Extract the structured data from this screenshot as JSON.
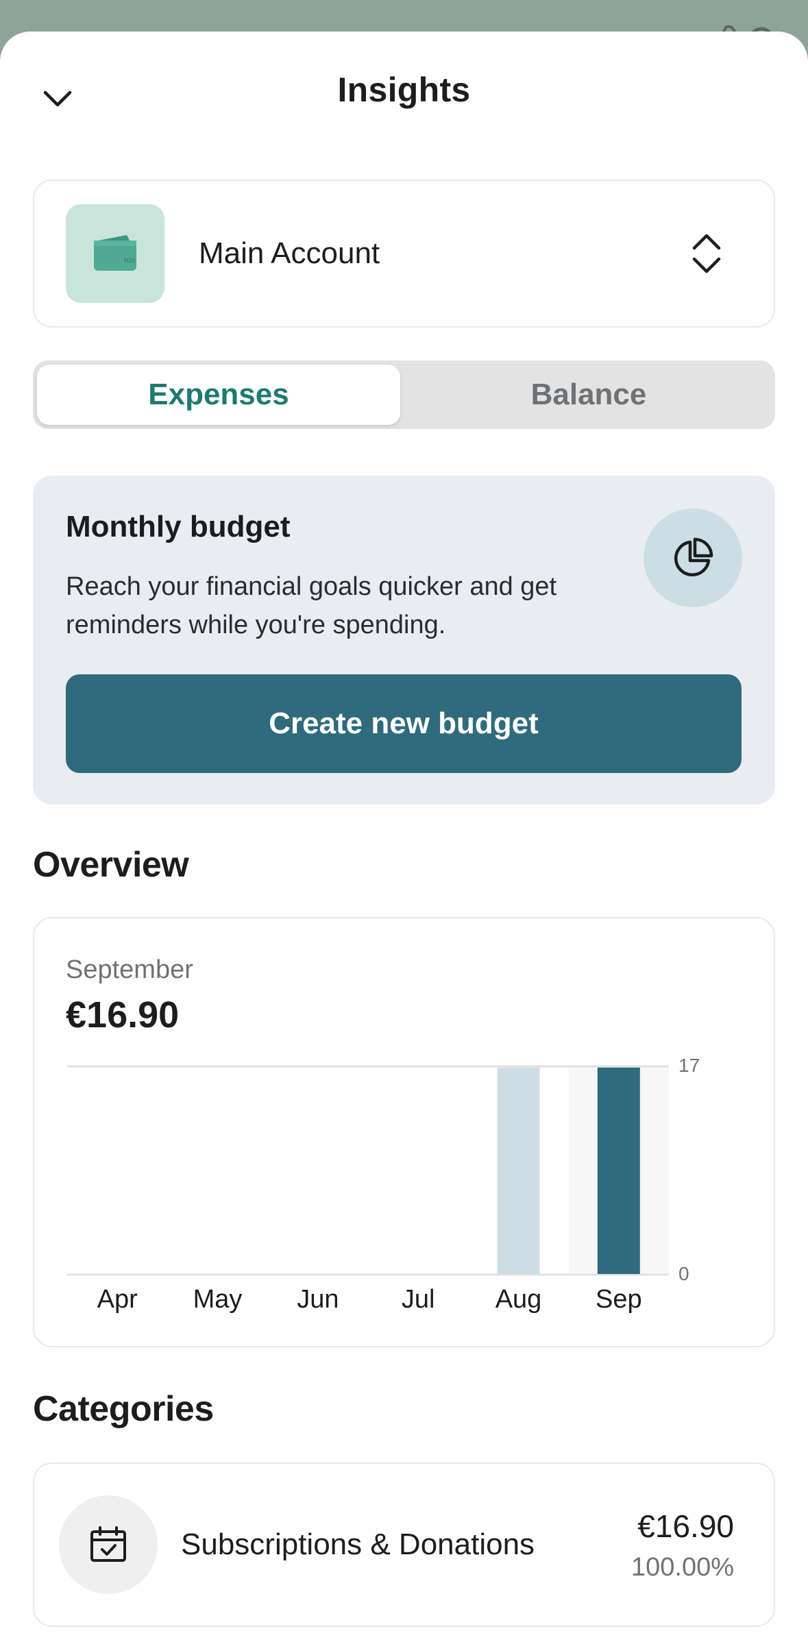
{
  "header": {
    "title": "Insights"
  },
  "account": {
    "name": "Main Account",
    "tile_color": "#c9e5db"
  },
  "tabs": [
    {
      "label": "Expenses",
      "active": true
    },
    {
      "label": "Balance",
      "active": false
    }
  ],
  "budget": {
    "title": "Monthly budget",
    "description": "Reach your financial goals quicker and get reminders while you're spending.",
    "button_label": "Create new budget"
  },
  "overview": {
    "section_title": "Overview",
    "selected_month": "September",
    "selected_total": "€16.90"
  },
  "chart_data": {
    "type": "bar",
    "categories": [
      "Apr",
      "May",
      "Jun",
      "Jul",
      "Aug",
      "Sep"
    ],
    "values": [
      0,
      0,
      0,
      0,
      16.9,
      16.9
    ],
    "yticks": [
      "17",
      "0"
    ],
    "ylim": [
      0,
      17
    ],
    "selected_index": 5,
    "colors": {
      "selected": "#2f6b7c",
      "default": "#cddde3",
      "highlight_bg": "#f7f7f7"
    }
  },
  "categories": {
    "section_title": "Categories",
    "items": [
      {
        "name": "Subscriptions & Donations",
        "amount": "€16.90",
        "percent": "100.00%"
      }
    ]
  },
  "colors": {
    "accent": "#1e7a70",
    "primary_button": "#2f6b7c",
    "budget_card_bg": "#e9edf1"
  }
}
